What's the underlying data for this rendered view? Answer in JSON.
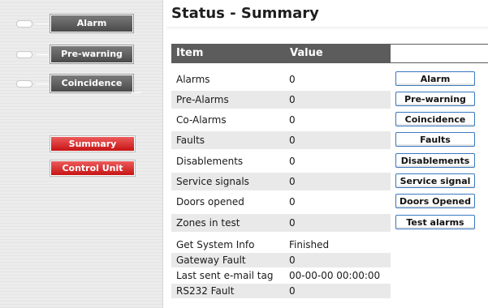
{
  "sidebar": {
    "indicators": [
      {
        "label": "Alarm"
      },
      {
        "label": "Pre-warning"
      },
      {
        "label": "Coincidence"
      }
    ],
    "nav": [
      {
        "label": "Summary"
      },
      {
        "label": "Control Unit"
      }
    ]
  },
  "main": {
    "title": "Status - Summary",
    "columns": {
      "item": "Item",
      "value": "Value"
    },
    "rows": [
      {
        "item": "Alarms",
        "value": "0",
        "button": "Alarm"
      },
      {
        "item": "Pre-Alarms",
        "value": "0",
        "button": "Pre-warning"
      },
      {
        "item": "Co-Alarms",
        "value": "0",
        "button": "Coincidence"
      },
      {
        "item": "Faults",
        "value": "0",
        "button": "Faults"
      },
      {
        "item": "Disablements",
        "value": "0",
        "button": "Disablements"
      },
      {
        "item": "Service signals",
        "value": "0",
        "button": "Service signal"
      },
      {
        "item": "Doors opened",
        "value": "0",
        "button": "Doors Opened"
      },
      {
        "item": "Zones in test",
        "value": "0",
        "button": "Test alarms"
      },
      {
        "item": "Get System Info",
        "value": "Finished"
      },
      {
        "item": "Gateway Fault",
        "value": "0"
      },
      {
        "item": "Last sent e-mail tag",
        "value": "00-00-00 00:00:00"
      },
      {
        "item": "RS232 Fault",
        "value": "0"
      }
    ]
  },
  "colors": {
    "header_bg": "#5c5c5c",
    "alt_row_bg": "#e9e9e9",
    "indicator_btn": "#5a5a5a",
    "nav_btn": "#d42020",
    "action_border": "#3b78c2"
  },
  "icons": [
    "status-led-icon"
  ]
}
